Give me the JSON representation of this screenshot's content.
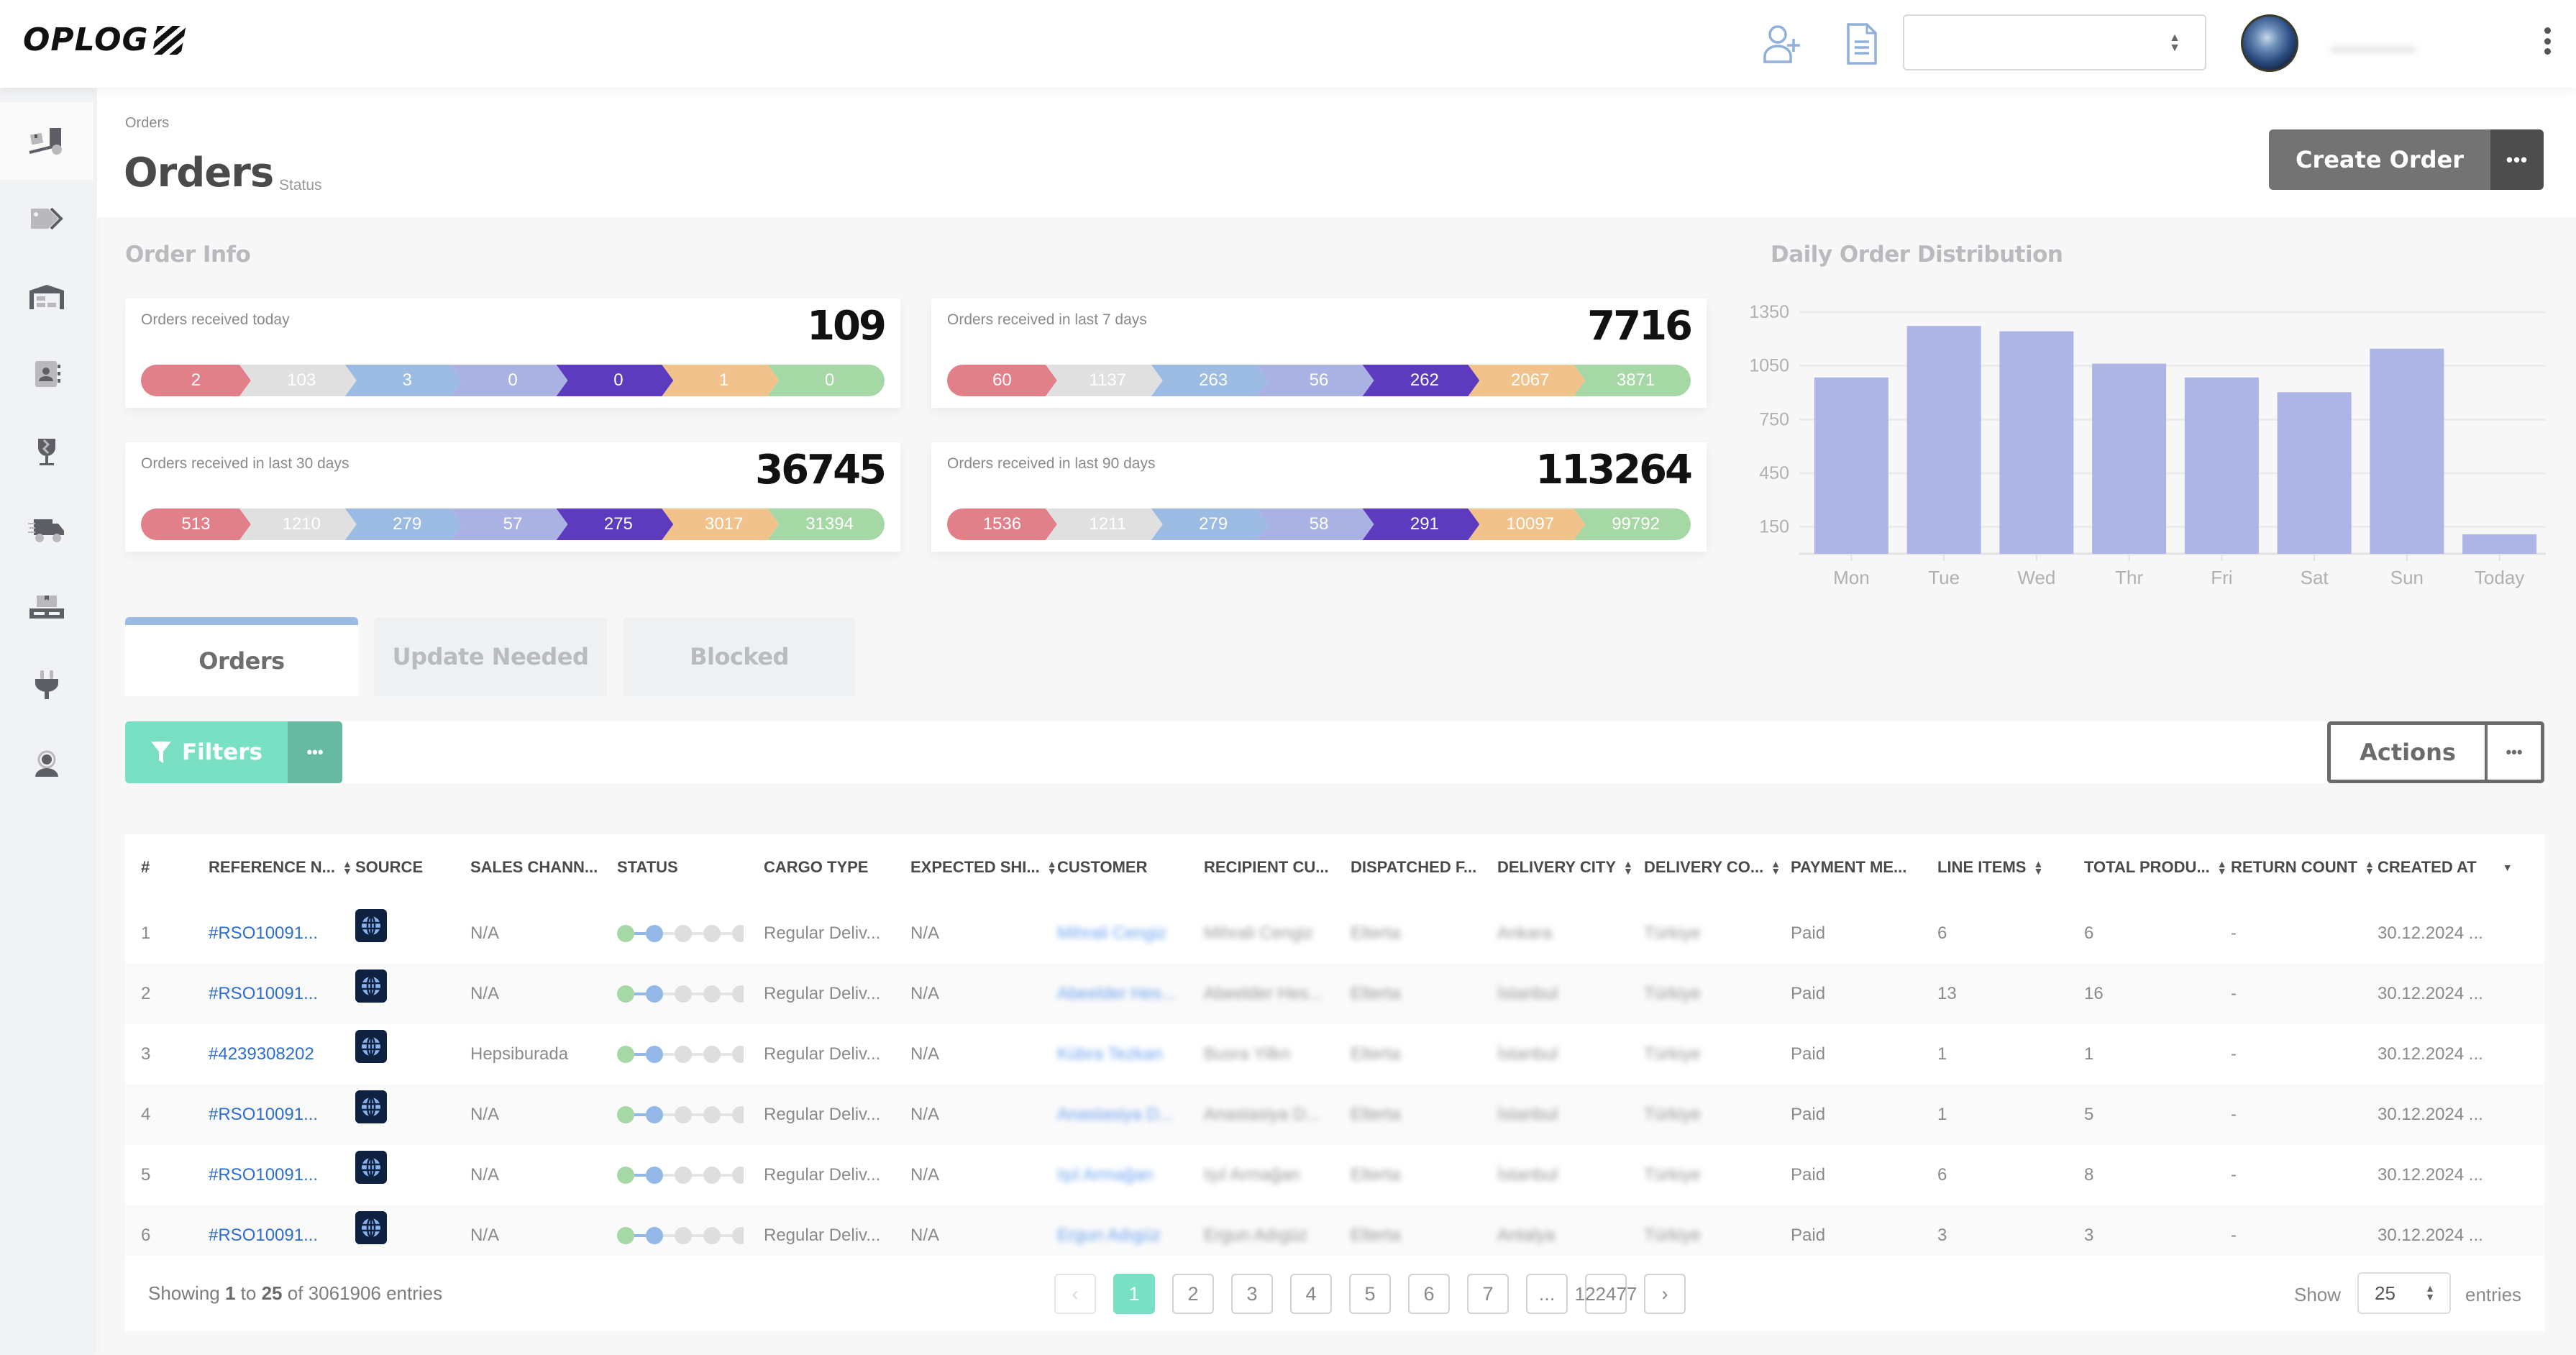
{
  "app": {
    "brand": "OPLOG"
  },
  "topbar": {
    "icons": [
      "add-user-icon",
      "document-icon"
    ],
    "select_value": "",
    "avatar": "globe-avatar",
    "menu_icon": "kebab-menu-icon"
  },
  "sidebar": {
    "items": [
      {
        "icon": "forklift-icon",
        "active": true
      },
      {
        "icon": "tags-icon",
        "active": false
      },
      {
        "icon": "warehouse-icon",
        "active": false
      },
      {
        "icon": "contacts-icon",
        "active": false
      },
      {
        "icon": "fragile-glass-icon",
        "active": false
      },
      {
        "icon": "delivery-truck-icon",
        "active": false
      },
      {
        "icon": "pallet-icon",
        "active": false
      },
      {
        "icon": "plug-icon",
        "active": false
      },
      {
        "icon": "support-agent-icon",
        "active": false
      }
    ]
  },
  "header": {
    "breadcrumb": "Orders",
    "title": "Orders",
    "subtitle": "Status",
    "create_label": "Create Order",
    "more_label": "•••"
  },
  "order_info": {
    "title": "Order Info",
    "stage_colors": [
      "#e2808a",
      "#e0e0e0",
      "#9bbbe3",
      "#a9b2e3",
      "#5c3bbf",
      "#f1c28b",
      "#a6d8a6"
    ],
    "cards": [
      {
        "label": "Orders received today",
        "total": "109",
        "stages": [
          "2",
          "103",
          "3",
          "0",
          "0",
          "1",
          "0"
        ]
      },
      {
        "label": "Orders received in last 7 days",
        "total": "7716",
        "stages": [
          "60",
          "1137",
          "263",
          "56",
          "262",
          "2067",
          "3871"
        ]
      },
      {
        "label": "Orders received in last 30 days",
        "total": "36745",
        "stages": [
          "513",
          "1210",
          "279",
          "57",
          "275",
          "3017",
          "31394"
        ]
      },
      {
        "label": "Orders received in last 90 days",
        "total": "113264",
        "stages": [
          "1536",
          "1211",
          "279",
          "58",
          "291",
          "10097",
          "99792"
        ]
      }
    ]
  },
  "chart_data": {
    "type": "bar",
    "title": "Daily Order Distribution",
    "categories": [
      "Mon",
      "Tue",
      "Wed",
      "Thr",
      "Fri",
      "Sat",
      "Sun",
      "Today"
    ],
    "values": [
      985,
      1273,
      1243,
      1062,
      985,
      903,
      1146,
      109
    ],
    "yticks": [
      150,
      450,
      750,
      1050,
      1350
    ],
    "ylim": [
      0,
      1350
    ],
    "xlabel": "",
    "ylabel": "",
    "grid": true,
    "legend": "none",
    "bar_color": "#acb5e5"
  },
  "tabs": [
    {
      "label": "Orders",
      "active": true
    },
    {
      "label": "Update Needed",
      "active": false
    },
    {
      "label": "Blocked",
      "active": false
    }
  ],
  "toolbar": {
    "filters_label": "Filters",
    "filters_more": "•••",
    "actions_label": "Actions",
    "actions_more": "•••"
  },
  "table": {
    "columns": [
      {
        "label": "#",
        "sortable": false
      },
      {
        "label": "REFERENCE N...",
        "sortable": true
      },
      {
        "label": "SOURCE",
        "sortable": false
      },
      {
        "label": "SALES CHANN...",
        "sortable": false
      },
      {
        "label": "STATUS",
        "sortable": false
      },
      {
        "label": "CARGO TYPE",
        "sortable": false
      },
      {
        "label": "EXPECTED SHI...",
        "sortable": true
      },
      {
        "label": "CUSTOMER",
        "sortable": false
      },
      {
        "label": "RECIPIENT CU...",
        "sortable": false
      },
      {
        "label": "DISPATCHED F...",
        "sortable": false
      },
      {
        "label": "DELIVERY CITY",
        "sortable": true
      },
      {
        "label": "DELIVERY CO...",
        "sortable": true
      },
      {
        "label": "PAYMENT ME...",
        "sortable": false
      },
      {
        "label": "LINE ITEMS",
        "sortable": true
      },
      {
        "label": "TOTAL PRODU...",
        "sortable": true
      },
      {
        "label": "RETURN COUNT",
        "sortable": true
      },
      {
        "label": "CREATED AT",
        "sortable": true,
        "sorted": "desc"
      }
    ],
    "status_step": 2,
    "rows": [
      {
        "num": "1",
        "ref": "#RSO10091...",
        "source": "globe-icon",
        "channel": "N/A",
        "cargo": "Regular Deliv...",
        "expected": "N/A",
        "customer": "Mihrali Cengiz",
        "recipient": "Mihrali Cengiz",
        "dispatched": "Elterta",
        "city": "Ankara",
        "country": "Türkiye",
        "payment": "Paid",
        "line_items": "6",
        "total_products": "6",
        "return_count": "-",
        "created": "30.12.2024 ..."
      },
      {
        "num": "2",
        "ref": "#RSO10091...",
        "source": "globe-icon",
        "channel": "N/A",
        "cargo": "Regular Deliv...",
        "expected": "N/A",
        "customer": "Abeelder Hes...",
        "recipient": "Abeelder Hes...",
        "dispatched": "Elterta",
        "city": "İstanbul",
        "country": "Türkiye",
        "payment": "Paid",
        "line_items": "13",
        "total_products": "16",
        "return_count": "-",
        "created": "30.12.2024 ..."
      },
      {
        "num": "3",
        "ref": "#4239308202",
        "source": "globe-icon",
        "channel": "Hepsiburada",
        "cargo": "Regular Deliv...",
        "expected": "N/A",
        "customer": "Kübra Tezkan",
        "recipient": "Busra Yilkn",
        "dispatched": "Elterta",
        "city": "İstanbul",
        "country": "Türkiye",
        "payment": "Paid",
        "line_items": "1",
        "total_products": "1",
        "return_count": "-",
        "created": "30.12.2024 ..."
      },
      {
        "num": "4",
        "ref": "#RSO10091...",
        "source": "globe-icon",
        "channel": "N/A",
        "cargo": "Regular Deliv...",
        "expected": "N/A",
        "customer": "Anastasiya D...",
        "recipient": "Anastasiya D...",
        "dispatched": "Elterta",
        "city": "İstanbul",
        "country": "Türkiye",
        "payment": "Paid",
        "line_items": "1",
        "total_products": "5",
        "return_count": "-",
        "created": "30.12.2024 ..."
      },
      {
        "num": "5",
        "ref": "#RSO10091...",
        "source": "globe-icon",
        "channel": "N/A",
        "cargo": "Regular Deliv...",
        "expected": "N/A",
        "customer": "Işıl Armağan",
        "recipient": "Işıl Armağan",
        "dispatched": "Elterta",
        "city": "İstanbul",
        "country": "Türkiye",
        "payment": "Paid",
        "line_items": "6",
        "total_products": "8",
        "return_count": "-",
        "created": "30.12.2024 ..."
      },
      {
        "num": "6",
        "ref": "#RSO10091...",
        "source": "globe-icon",
        "channel": "N/A",
        "cargo": "Regular Deliv...",
        "expected": "N/A",
        "customer": "Ergun Adıgüz",
        "recipient": "Ergun Adıgüz",
        "dispatched": "Elterta",
        "city": "Antalya",
        "country": "Türkiye",
        "payment": "Paid",
        "line_items": "3",
        "total_products": "3",
        "return_count": "-",
        "created": "30.12.2024 ..."
      }
    ]
  },
  "footer": {
    "showing_prefix": "Showing",
    "showing_from": "1",
    "showing_to_word": "to",
    "showing_to": "25",
    "showing_of": "of 3061906 entries",
    "pages": [
      "1",
      "2",
      "3",
      "4",
      "5",
      "6",
      "7",
      "...",
      "122477"
    ],
    "active_page": "1",
    "prev": "‹",
    "next": "›",
    "show_label": "Show",
    "page_size": "25",
    "entries_label": "entries"
  }
}
